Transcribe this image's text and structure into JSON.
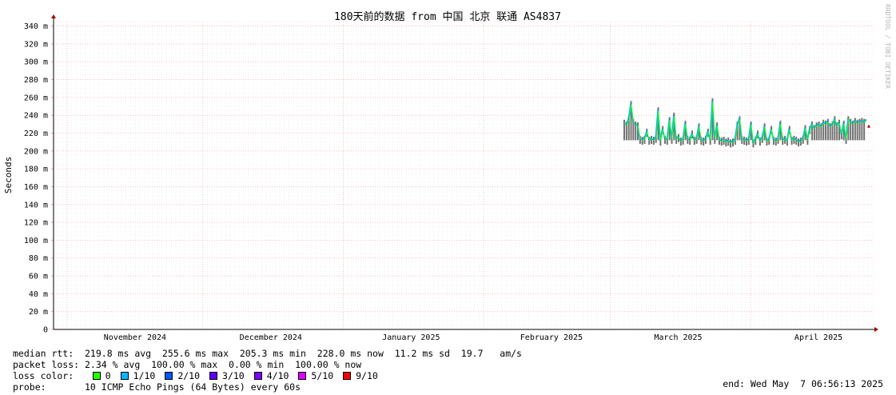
{
  "title": "180天前的数据 from 中国 北京 联通 AS4837",
  "watermark": "RRDTOOL / TOBI OETIKER",
  "chart_data": {
    "type": "line",
    "ylabel": "Seconds",
    "ylim": [
      0,
      345
    ],
    "ytick_values": [
      0,
      20,
      40,
      60,
      80,
      100,
      120,
      140,
      160,
      180,
      200,
      220,
      240,
      260,
      280,
      300,
      320,
      340
    ],
    "ytick_labels": [
      "0",
      "20 m",
      "40 m",
      "60 m",
      "80 m",
      "100 m",
      "120 m",
      "140 m",
      "160 m",
      "180 m",
      "200 m",
      "220 m",
      "240 m",
      "260 m",
      "280 m",
      "300 m",
      "320 m",
      "340 m"
    ],
    "x_labels": [
      "November 2024",
      "December 2024",
      "January 2025",
      "February 2025",
      "March 2025",
      "April 2025"
    ],
    "x_label_days": [
      18,
      48,
      79,
      110,
      138,
      169
    ],
    "x_major_days": [
      3,
      33,
      64,
      95,
      123,
      154
    ],
    "xlim_days": [
      0,
      181
    ],
    "grid": true,
    "series": [
      {
        "name": "median rtt",
        "x_day": [
          126.0,
          126.5,
          127.0,
          127.5,
          128.0,
          128.5,
          129.0,
          129.5,
          130.0,
          130.5,
          131.0,
          131.5,
          132.0,
          132.5,
          133.0,
          133.5,
          134.0,
          134.5,
          135.0,
          135.5,
          136.0,
          136.5,
          137.0,
          137.5,
          138.0,
          138.5,
          139.0,
          139.5,
          140.0,
          140.5,
          141.0,
          141.5,
          142.0,
          142.5,
          143.0,
          143.5,
          144.0,
          144.5,
          145.0,
          145.5,
          146.0,
          146.5,
          147.0,
          147.5,
          148.0,
          148.5,
          149.0,
          149.5,
          150.0,
          150.5,
          151.0,
          151.5,
          152.0,
          152.5,
          153.0,
          153.5,
          154.0,
          154.5,
          155.0,
          155.5,
          156.0,
          156.5,
          157.0,
          157.5,
          158.0,
          158.5,
          159.0,
          159.5,
          160.0,
          160.5,
          161.0,
          161.5,
          162.0,
          162.5,
          163.0,
          163.5,
          164.0,
          164.5,
          165.0,
          165.5,
          166.0,
          166.5,
          167.0,
          167.5,
          168.0,
          168.5,
          169.0,
          169.5,
          170.0,
          170.5,
          171.0,
          171.5,
          172.0,
          172.5,
          173.0,
          173.5,
          174.0,
          174.5,
          175.0,
          175.5,
          176.0,
          176.5,
          177.0,
          177.5,
          178.0,
          178.5,
          179.0,
          179.5
        ],
        "y_ms": [
          232,
          230,
          236,
          253,
          233,
          230,
          229,
          214,
          213,
          214,
          222,
          213,
          214,
          213,
          215,
          246,
          212,
          225,
          214,
          213,
          235,
          214,
          240,
          214,
          216,
          212,
          213,
          231,
          214,
          213,
          220,
          213,
          214,
          228,
          213,
          212,
          214,
          222,
          213,
          256,
          214,
          229,
          213,
          212,
          213,
          211,
          212,
          210,
          211,
          213,
          230,
          236,
          214,
          213,
          212,
          213,
          230,
          210,
          213,
          220,
          212,
          215,
          228,
          212,
          213,
          225,
          213,
          212,
          214,
          231,
          213,
          214,
          212,
          225,
          213,
          214,
          213,
          211,
          212,
          214,
          226,
          213,
          225,
          230,
          226,
          229,
          230,
          228,
          232,
          231,
          233,
          228,
          230,
          236,
          229,
          232,
          219,
          231,
          214,
          236,
          233,
          231,
          234,
          232,
          233,
          234,
          233,
          235
        ]
      }
    ]
  },
  "stats": {
    "median_rtt": "median rtt:  219.8 ms avg  255.6 ms max  205.3 ms min  228.0 ms now  11.2 ms sd  19.7   am/s",
    "packet_loss": "packet loss: 2.34 % avg  100.00 % max  0.00 % min  100.00 % now",
    "loss_color_label": "loss color:",
    "probe": "probe:       10 ICMP Echo Pings (64 Bytes) every 60s",
    "end": "end: Wed May  7 06:56:13 2025"
  },
  "loss_colors": [
    {
      "label": "0",
      "color": "#26ff00"
    },
    {
      "label": "1/10",
      "color": "#00b8ff"
    },
    {
      "label": "2/10",
      "color": "#0059ff"
    },
    {
      "label": "3/10",
      "color": "#5e00ff"
    },
    {
      "label": "4/10",
      "color": "#7e00ff"
    },
    {
      "label": "5/10",
      "color": "#dd00ff"
    },
    {
      "label": "9/10",
      "color": "#ff0000"
    }
  ]
}
